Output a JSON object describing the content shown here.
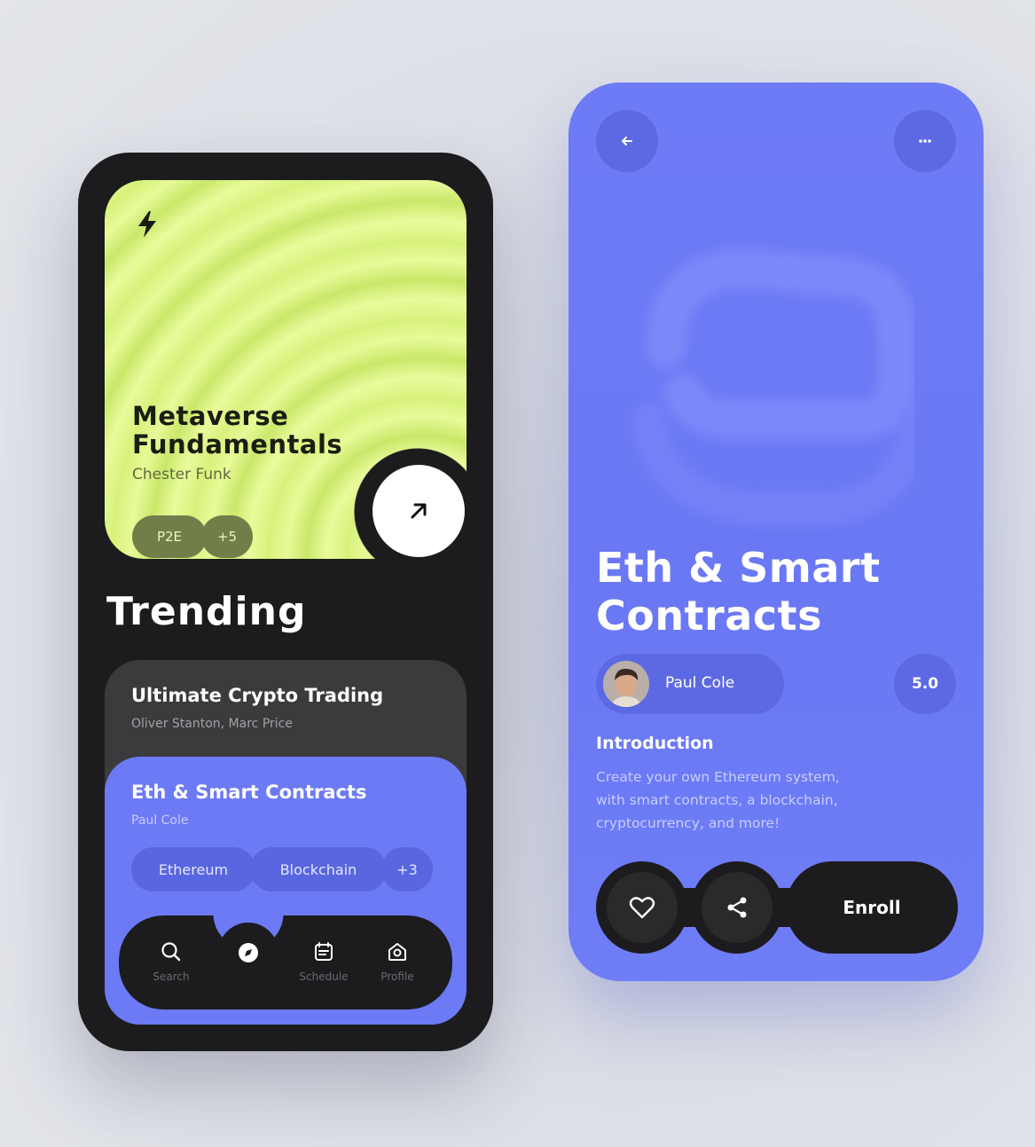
{
  "left_screen": {
    "featured": {
      "icon": "lightning-bolt-icon",
      "title_line1": "Metaverse",
      "title_line2": "Fundamentals",
      "author": "Chester Funk",
      "tags": [
        "P2E",
        "+5"
      ],
      "open_icon": "arrow-up-right-icon"
    },
    "section_title": "Trending",
    "courses": [
      {
        "title": "Ultimate Crypto Trading",
        "authors": "Oliver Stanton, Marc Price"
      },
      {
        "title": "Eth & Smart Contracts",
        "authors": "Paul Cole",
        "tags": [
          "Ethereum",
          "Blockchain",
          "+3"
        ]
      }
    ],
    "nav": {
      "items": [
        {
          "label": "Search",
          "icon": "search-icon"
        },
        {
          "label": "",
          "icon": "compass-icon",
          "active": true
        },
        {
          "label": "Schedule",
          "icon": "calendar-icon"
        },
        {
          "label": "Profile",
          "icon": "profile-icon"
        }
      ]
    }
  },
  "right_screen": {
    "back_icon": "arrow-left-icon",
    "more_icon": "more-dots-icon",
    "title_line1": "Eth & Smart",
    "title_line2": "Contracts",
    "author": "Paul Cole",
    "rating": "5.0",
    "intro_heading": "Introduction",
    "intro_line1": "Create your own Ethereum system,",
    "intro_line2": "with smart contracts, a blockchain,",
    "intro_line3": "cryptocurrency, and more!",
    "actions": {
      "like_icon": "heart-icon",
      "share_icon": "share-icon",
      "enroll_label": "Enroll"
    }
  },
  "colors": {
    "lime": "#dcf480",
    "blue": "#6d7af5",
    "dark": "#1c1c1e"
  }
}
